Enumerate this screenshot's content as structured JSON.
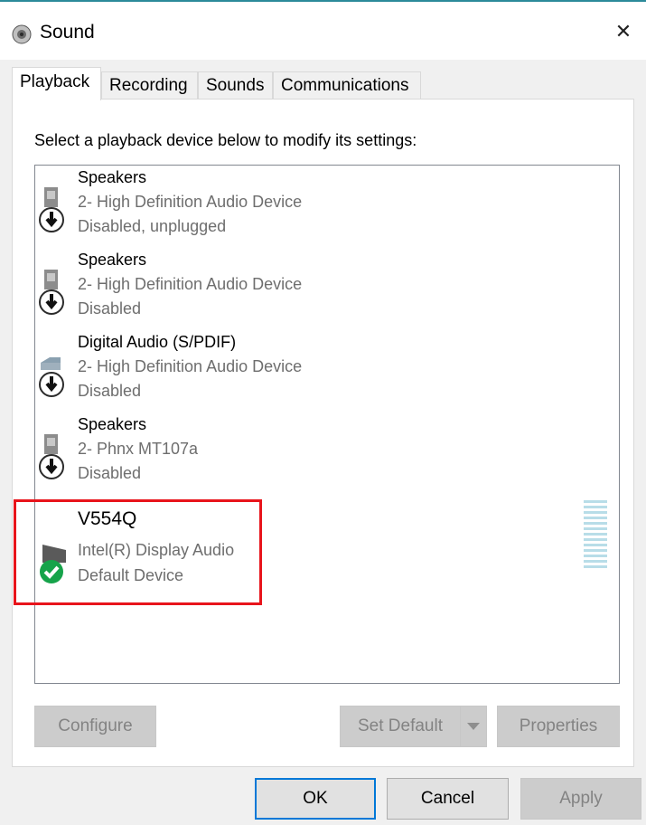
{
  "window": {
    "title": "Sound",
    "close_label": "✕"
  },
  "tabs": [
    {
      "label": "Playback"
    },
    {
      "label": "Recording"
    },
    {
      "label": "Sounds"
    },
    {
      "label": "Communications"
    }
  ],
  "instruction": "Select a playback device below to modify its settings:",
  "devices": [
    {
      "name": "Speakers",
      "detail": "2- High Definition Audio Device",
      "status": "Disabled, unplugged"
    },
    {
      "name": "Speakers",
      "detail": "2- High Definition Audio Device",
      "status": "Disabled"
    },
    {
      "name": "Digital Audio (S/PDIF)",
      "detail": "2- High Definition Audio Device",
      "status": "Disabled"
    },
    {
      "name": "Speakers",
      "detail": "2- Phnx MT107a",
      "status": "Disabled"
    },
    {
      "name": "V554Q",
      "detail": "Intel(R) Display Audio",
      "status": "Default Device"
    }
  ],
  "buttons": {
    "configure": "Configure",
    "set_default": "Set Default",
    "properties": "Properties",
    "ok": "OK",
    "cancel": "Cancel",
    "apply": "Apply"
  },
  "colors": {
    "highlight": "#e8141b",
    "default_check": "#16a34a",
    "accent": "#0078d7"
  }
}
